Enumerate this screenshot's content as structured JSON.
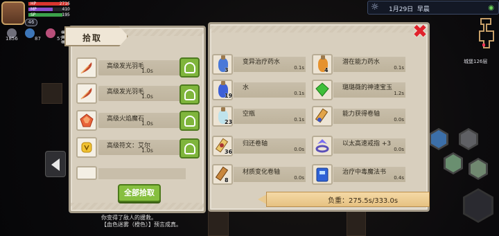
{
  "hud": {
    "hp_label": "HP",
    "hp_value": "2716",
    "hp_color": "#d9352f",
    "mp_label": "MP",
    "mp_value": "410",
    "mp_color": "#8a4fcf",
    "sp_label": "SP",
    "sp_value": "195",
    "sp_color": "#3ba24a",
    "level": "46",
    "stats": [
      "1856",
      "87",
      "57"
    ],
    "date": "1月29日",
    "time_of_day": "早晨",
    "floor": "城堡126层"
  },
  "pickup_panel": {
    "title": "拾取",
    "items": [
      {
        "name": "高级发光羽毛",
        "time": "1.0s",
        "icon": "feather-icon"
      },
      {
        "name": "高级发光羽毛",
        "time": "1.0s",
        "icon": "feather-icon"
      },
      {
        "name": "高级火焰魔石",
        "time": "1.0s",
        "icon": "fire-gem-icon"
      },
      {
        "name": "高级符文：艾尔",
        "time": "1.0s",
        "icon": "rune-icon"
      }
    ],
    "pick_all_label": "全部拾取"
  },
  "inventory": {
    "items": [
      {
        "name": "变异治疗药水",
        "time": "0.1s",
        "count": "3",
        "icon": "mutant-potion-icon"
      },
      {
        "name": "潜在能力药水",
        "time": "0.1s",
        "count": "4",
        "icon": "potential-potion-icon"
      },
      {
        "name": "水",
        "time": "0.1s",
        "count": "19",
        "icon": "water-icon"
      },
      {
        "name": "璐璐薇的神速宝玉",
        "time": "1.2s",
        "count": "",
        "icon": "green-gem-icon"
      },
      {
        "name": "空瓶",
        "time": "0.1s",
        "count": "23",
        "icon": "empty-bottle-icon"
      },
      {
        "name": "能力获得卷轴",
        "time": "0.0s",
        "count": "",
        "icon": "ability-scroll-icon"
      },
      {
        "name": "归还卷轴",
        "time": "0.0s",
        "count": "36",
        "icon": "return-scroll-icon"
      },
      {
        "name": "以太高速戒指 +3",
        "time": "0.0s",
        "count": "",
        "icon": "ether-ring-icon"
      },
      {
        "name": "材质变化卷轴",
        "time": "0.0s",
        "count": "8",
        "icon": "material-scroll-icon"
      },
      {
        "name": "治疗中毒魔法书",
        "time": "0.4s",
        "count": "",
        "icon": "spellbook-icon"
      }
    ],
    "weight_text": "负重：275.5s/333.0s"
  },
  "bottom": {
    "line1": "你变得了敌人的援救。",
    "line2": "【血色迷雾（橙色）】预言成真。"
  }
}
